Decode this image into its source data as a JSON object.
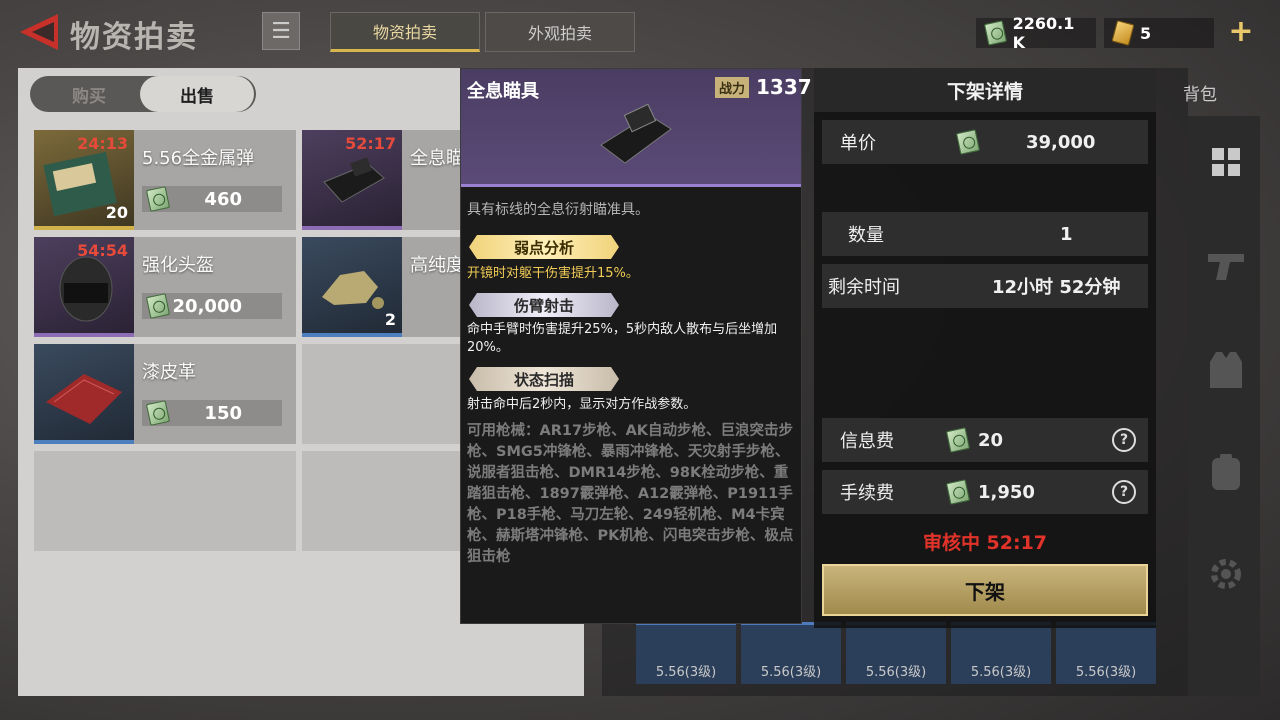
{
  "header": {
    "title": "物资拍卖",
    "tabs": [
      {
        "label": "物资拍卖",
        "active": true
      },
      {
        "label": "外观拍卖",
        "active": false
      }
    ],
    "currency": {
      "cash": "2260.1 K",
      "tickets": "5"
    }
  },
  "left": {
    "segments": {
      "buy": "购买",
      "sell": "出售"
    },
    "items": [
      {
        "name": "5.56全金属弹",
        "timer": "24:13",
        "qty": "20",
        "price": "460",
        "rarity": "gold"
      },
      {
        "name": "全息瞄具",
        "timer": "52:17",
        "qty": "",
        "price": "",
        "rarity": "purple"
      },
      {
        "name": "强化头盔",
        "timer": "54:54",
        "qty": "",
        "price": "20,000",
        "rarity": "purple"
      },
      {
        "name": "高纯度",
        "timer": "",
        "qty": "2",
        "price": "",
        "rarity": "blue"
      },
      {
        "name": "漆皮革",
        "timer": "",
        "qty": "",
        "price": "150",
        "rarity": "blue"
      }
    ]
  },
  "tooltip": {
    "name": "全息瞄具",
    "power_label": "战力",
    "power_value": "1337",
    "description": "具有标线的全息衍射瞄准具。",
    "traits": [
      {
        "title": "弱点分析",
        "text": "开镜时对躯干伤害提升15%。"
      },
      {
        "title": "伤臂射击",
        "text": "命中手臂时伤害提升25%，5秒内敌人散布与后坐增加20%。"
      },
      {
        "title": "状态扫描",
        "text": "射击命中后2秒内，显示对方作战参数。"
      }
    ],
    "weapons": "可用枪械：AR17步枪、AK自动步枪、巨浪突击步枪、SMG5冲锋枪、暴雨冲锋枪、天灾射手步枪、说服者狙击枪、DMR14步枪、98K栓动步枪、重踏狙击枪、1897霰弹枪、A12霰弹枪、P1911手枪、P18手枪、马刀左轮、249轻机枪、M4卡宾枪、赫斯塔冲锋枪、PK机枪、闪电突击步枪、极点狙击枪"
  },
  "detail": {
    "title": "下架详情",
    "unit_price_label": "单价",
    "unit_price": "39,000",
    "quantity_label": "数量",
    "quantity": "1",
    "remaining_label": "剩余时间",
    "remaining": "12小时 52分钟",
    "info_fee_label": "信息费",
    "info_fee": "20",
    "handling_fee_label": "手续费",
    "handling_fee": "1,950",
    "review_status": "审核中 52:17",
    "unlist_button": "下架"
  },
  "background": {
    "bag_tab": "背包",
    "ammo_label": "5.56(3级)"
  }
}
